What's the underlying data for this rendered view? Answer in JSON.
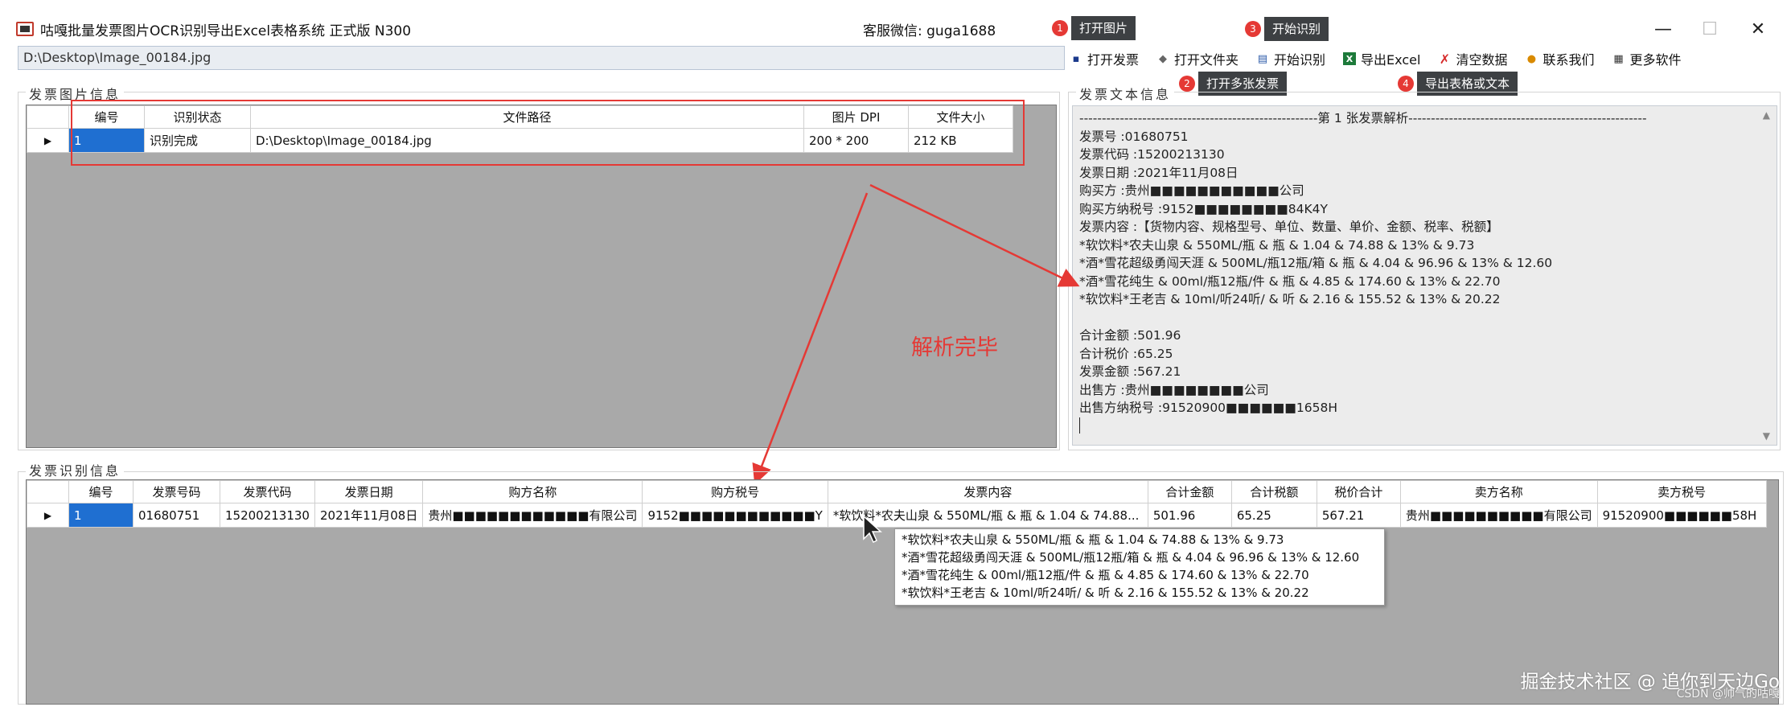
{
  "window": {
    "title": "咕嘎批量发票图片OCR识别导出Excel表格系统  正式版 N300",
    "contact": "客服微信: guga1688",
    "min_label": "—",
    "max_label": "☐",
    "close_label": "✕"
  },
  "tips": [
    {
      "num": "1",
      "label": "打开图片"
    },
    {
      "num": "2",
      "label": "打开多张发票"
    },
    {
      "num": "3",
      "label": "开始识别"
    },
    {
      "num": "4",
      "label": "导出表格或文本"
    }
  ],
  "path_field": {
    "value": "D:\\Desktop\\Image_00184.jpg"
  },
  "toolbar": [
    {
      "label": "打开发票",
      "icon": "open-invoice-icon",
      "glyph": "▪",
      "color": "#1b3a8c"
    },
    {
      "label": "打开文件夹",
      "icon": "folder-icon",
      "glyph": "◆",
      "color": "#666"
    },
    {
      "label": "开始识别",
      "icon": "recognize-icon",
      "glyph": "▤",
      "color": "#2b5aa8"
    },
    {
      "label": "导出Excel",
      "icon": "excel-icon",
      "glyph": "X",
      "color": "#1d7a3a"
    },
    {
      "label": "清空数据",
      "icon": "clear-icon",
      "glyph": "✗",
      "color": "#d62b2b"
    },
    {
      "label": "联系我们",
      "icon": "contact-qq-icon",
      "glyph": "●",
      "color": "#d98a00"
    },
    {
      "label": "更多软件",
      "icon": "more-apps-icon",
      "glyph": "▦",
      "color": "#333"
    }
  ],
  "image_group": {
    "title": "发票图片信息",
    "columns": [
      "编号",
      "识别状态",
      "文件路径",
      "图片 DPI",
      "文件大小"
    ],
    "rows": [
      {
        "id": "1",
        "status": "识别完成",
        "path": "D:\\Desktop\\Image_00184.jpg",
        "dpi": "200 * 200",
        "size": "212 KB"
      }
    ]
  },
  "text_group": {
    "title": "发票文本信息",
    "lines": [
      "-----------------------------------------------------第 1 张发票解析-----------------------------------------------------",
      "发票号 :01680751",
      "发票代码 :15200213130",
      "发票日期 :2021年11月08日",
      "购买方 :贵州■■■■■■■■■■■公司",
      "购买方纳税号 :9152■■■■■■■■84K4Y",
      "发票内容 :【货物内容、规格型号、单位、数量、单价、金额、税率、税额】",
      "*软饮料*农夫山泉 & 550ML/瓶 & 瓶 & 1.04 & 74.88 & 13% & 9.73",
      "*酒*雪花超级勇闯天涯 & 500ML/瓶12瓶/箱 & 瓶 & 4.04 & 96.96 & 13% & 12.60",
      "*酒*雪花纯生 & 00ml/瓶12瓶/件 & 瓶 & 4.85 & 174.60 & 13% & 22.70",
      "*软饮料*王老吉 & 10ml/听24听/ & 听 & 2.16 & 155.52 & 13% & 20.22",
      "",
      "合计金额 :501.96",
      "合计税价 :65.25",
      "发票金额 :567.21",
      "出售方 :贵州■■■■■■■■公司",
      "出售方纳税号 :91520900■■■■■■1658H"
    ]
  },
  "annotation": "解析完毕",
  "result_group": {
    "title": "发票识别信息",
    "columns": [
      "编号",
      "发票号码",
      "发票代码",
      "发票日期",
      "购方名称",
      "购方税号",
      "发票内容",
      "合计金额",
      "合计税额",
      "税价合计",
      "卖方名称",
      "卖方税号"
    ],
    "rows": [
      {
        "id": "1",
        "number": "01680751",
        "code": "15200213130",
        "date": "2021年11月08日",
        "buyer": "贵州■■■■■■■■■■■■有限公司",
        "buyer_tax": "9152■■■■■■■■■■■■Y",
        "content": "*软饮料*农夫山泉 & 550ML/瓶 & 瓶 & 1.04 & 74.88...",
        "total": "501.96",
        "tax": "65.25",
        "grand": "567.21",
        "seller": "贵州■■■■■■■■■■有限公司",
        "seller_tax": "91520900■■■■■■58H"
      }
    ]
  },
  "popup": {
    "lines": [
      "*软饮料*农夫山泉 & 550ML/瓶 & 瓶 & 1.04 & 74.88 & 13% & 9.73",
      "*酒*雪花超级勇闯天涯 & 500ML/瓶12瓶/箱 & 瓶 & 4.04 & 96.96 & 13% & 12.60",
      "*酒*雪花纯生 & 00ml/瓶12瓶/件 & 瓶 & 4.85 & 174.60 & 13% & 22.70",
      "*软饮料*王老吉 & 10ml/听24听/ & 听 & 2.16 & 155.52 & 13% & 20.22"
    ]
  },
  "watermark": {
    "main": "掘金技术社区 @ 追你到天边Go",
    "sub": "CSDN @帅气的咕嘎"
  },
  "colors": {
    "accent_red": "#e53935",
    "selection_blue": "#1f6fd1",
    "grid_gray": "#a9a9a9"
  }
}
